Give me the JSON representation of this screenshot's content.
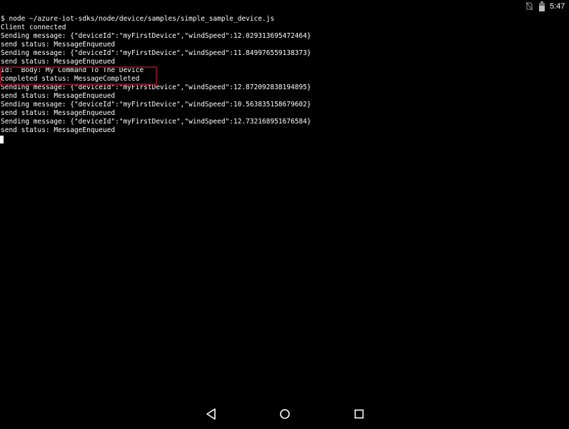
{
  "status_bar": {
    "time": "5:47",
    "icons": [
      "no-sim-icon",
      "battery-icon"
    ],
    "text_color": "#ffffff"
  },
  "terminal": {
    "background": "#000000",
    "text_color": "#ffffff",
    "lines": [
      "$ node ~/azure-iot-sdks/node/device/samples/simple_sample_device.js",
      "Client connected",
      "Sending message: {\"deviceId\":\"myFirstDevice\",\"windSpeed\":12.029313695472464}",
      "send status: MessageEnqueued",
      "Sending message: {\"deviceId\":\"myFirstDevice\",\"windSpeed\":11.849976559138373}",
      "send status: MessageEnqueued",
      "Id:  Body: My Command To The Device",
      "completed status: MessageCompleted",
      "Sending message: {\"deviceId\":\"myFirstDevice\",\"windSpeed\":12.872092838194895}",
      "send status: MessageEnqueued",
      "Sending message: {\"deviceId\":\"myFirstDevice\",\"windSpeed\":10.563835158679602}",
      "send status: MessageEnqueued",
      "Sending message: {\"deviceId\":\"myFirstDevice\",\"windSpeed\":12.732168951676584}",
      "send status: MessageEnqueued"
    ],
    "highlight_color": "#7a1020"
  },
  "nav_bar": {
    "buttons": [
      "back-icon",
      "home-icon",
      "recents-icon"
    ],
    "icon_color": "#ffffff"
  }
}
